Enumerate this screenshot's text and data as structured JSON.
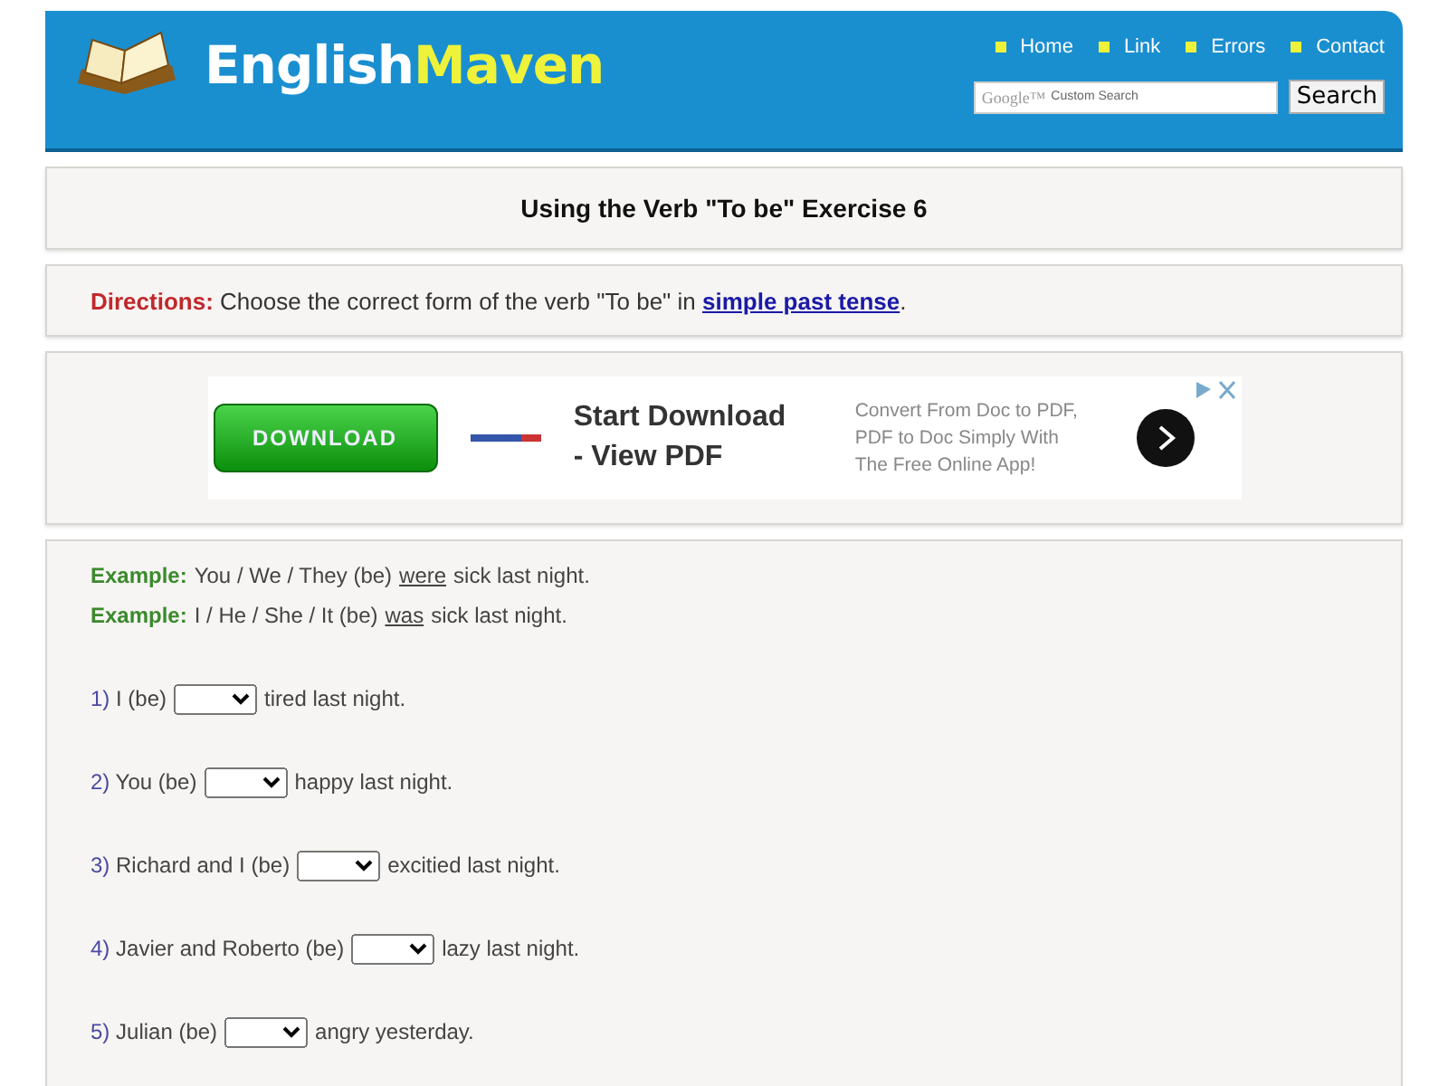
{
  "header": {
    "logo_first": "English",
    "logo_second": "Maven",
    "nav": [
      "Home",
      "Link",
      "Errors",
      "Contact"
    ],
    "search": {
      "placeholder": "Custom Search",
      "brand": "Google™",
      "button": "Search"
    }
  },
  "title": "Using the Verb \"To be\" Exercise 6",
  "directions": {
    "label": "Directions:",
    "text": "Choose the correct form of the verb \"To be\" in",
    "link": "simple past tense",
    "end": "."
  },
  "ad": {
    "button": "DOWNLOAD",
    "headline": [
      "Start Download",
      "- View PDF"
    ],
    "body": [
      "Convert From Doc to PDF,",
      "PDF to Doc Simply With",
      "The Free Online App!"
    ]
  },
  "examples": [
    {
      "label": "Example:",
      "before": "You / We / They (be)",
      "answer": "were",
      "after": "sick last night."
    },
    {
      "label": "Example:",
      "before": "I / He / She / It (be)",
      "answer": "was",
      "after": "sick last night."
    }
  ],
  "questions": [
    {
      "number": "1)",
      "before": "I (be)",
      "after": "tired last night."
    },
    {
      "number": "2)",
      "before": "You (be)",
      "after": "happy last night."
    },
    {
      "number": "3)",
      "before": "Richard and I (be)",
      "after": "excitied last night."
    },
    {
      "number": "4)",
      "before": "Javier and Roberto (be)",
      "after": "lazy last night."
    },
    {
      "number": "5)",
      "before": "Julian (be)",
      "after": "angry yesterday."
    }
  ]
}
